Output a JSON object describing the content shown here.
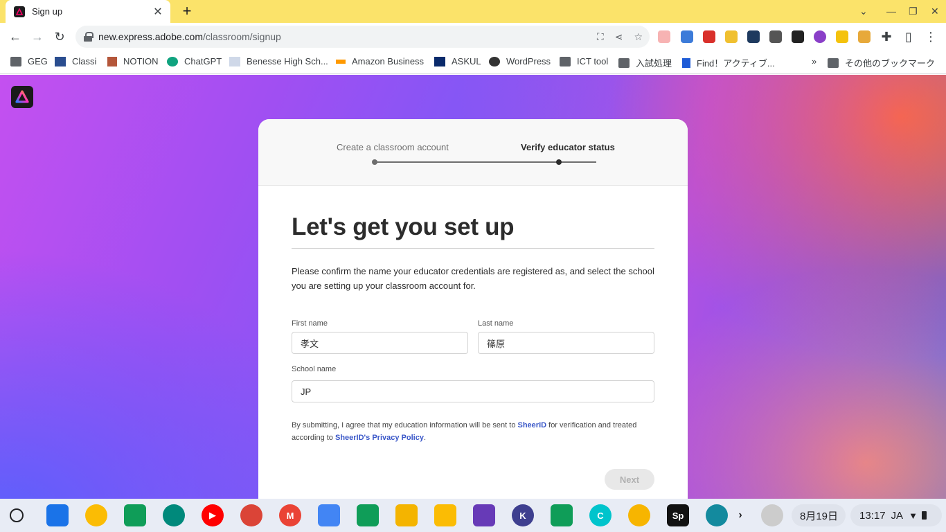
{
  "browser": {
    "tab_title": "Sign up",
    "tab_close": "✕",
    "new_tab": "+",
    "url_host": "new.express.adobe.com",
    "url_path": "/classroom/signup",
    "bookmarks": [
      "GEG",
      "Classi",
      "NOTION",
      "ChatGPT",
      "Benesse High Sch...",
      "Amazon Business",
      "ASKUL",
      "WordPress",
      "ICT tool",
      "入試処理",
      "Find！アクティブ...",
      "その他のブックマーク"
    ]
  },
  "stepper": {
    "step1": "Create a classroom account",
    "step2": "Verify educator status"
  },
  "form": {
    "heading": "Let's get you set up",
    "description": "Please confirm the name your educator credentials are registered as, and select the school you are setting up your classroom account for.",
    "first_name_label": "First name",
    "first_name_value": "孝文",
    "last_name_label": "Last name",
    "last_name_value": "篠原",
    "school_label": "School name",
    "school_value": "JP",
    "legal_prefix": "By submitting, I agree that my education information will be sent to ",
    "legal_link1": "SheerID",
    "legal_middle": " for verification and treated according to ",
    "legal_link2": "SheerID's Privacy Policy",
    "legal_suffix": ".",
    "next_label": "Next"
  },
  "shelf": {
    "date": "8月19日",
    "time": "13:17",
    "ime": "JA"
  },
  "colors": {
    "tabstrip": "#fbe36a",
    "link": "#3a57c8",
    "card": "#ffffff"
  }
}
